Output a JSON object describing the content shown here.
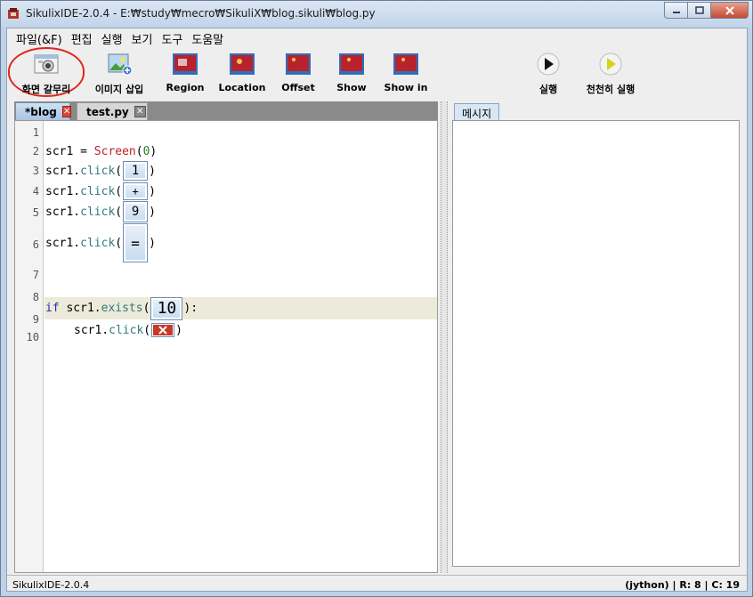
{
  "window": {
    "title": "SikulixIDE-2.0.4 - E:₩study₩mecro₩SikuliX₩blog.sikuli₩blog.py"
  },
  "menu": [
    "파일(&F)",
    "편집",
    "실행",
    "보기",
    "도구",
    "도움말"
  ],
  "toolbar": {
    "capture": "화면 갈무리",
    "insert_image": "이미지 삽입",
    "region": "Region",
    "location": "Location",
    "offset": "Offset",
    "show": "Show",
    "show_in": "Show in",
    "run": "실행",
    "run_slow": "천천히 실행"
  },
  "tabs": [
    {
      "label": "*blog",
      "active": true
    },
    {
      "label": "test.py",
      "active": false
    }
  ],
  "editor": {
    "line_numbers": [
      "1",
      "2",
      "3",
      "4",
      "5",
      "6",
      "7",
      "8",
      "9",
      "10"
    ],
    "lines": {
      "l2": {
        "var": "scr1",
        "op": " = ",
        "cls": "Screen",
        "open": "(",
        "arg": "0",
        "close": ")"
      },
      "l3": {
        "var": "scr1.",
        "fn": "click",
        "open": "(",
        "thumb": "1",
        "close": ")"
      },
      "l4": {
        "var": "scr1.",
        "fn": "click",
        "open": "(",
        "thumb": "+",
        "close": ")"
      },
      "l5": {
        "var": "scr1.",
        "fn": "click",
        "open": "(",
        "thumb": "9",
        "close": ")"
      },
      "l6": {
        "var": "scr1.",
        "fn": "click",
        "open": "(",
        "thumb": "=",
        "close": ")"
      },
      "l8": {
        "kw": "if",
        "var": " scr1.",
        "fn": "exists",
        "open": "(",
        "thumb": "10",
        "close": "):"
      },
      "l9": {
        "var": "scr1.",
        "fn": "click",
        "open": "(",
        "close": ")"
      }
    }
  },
  "messages": {
    "tab": "메시지"
  },
  "status": {
    "left": "SikulixIDE-2.0.4",
    "right": "(jython) | R: 8 | C: 19"
  },
  "colors": {
    "keyword": "#2a2ab3",
    "function": "#2f7a7f",
    "class": "#c02020",
    "number": "#2a7a2a",
    "highlight_line": "#ecead9",
    "capture_ring": "#e0261d"
  }
}
